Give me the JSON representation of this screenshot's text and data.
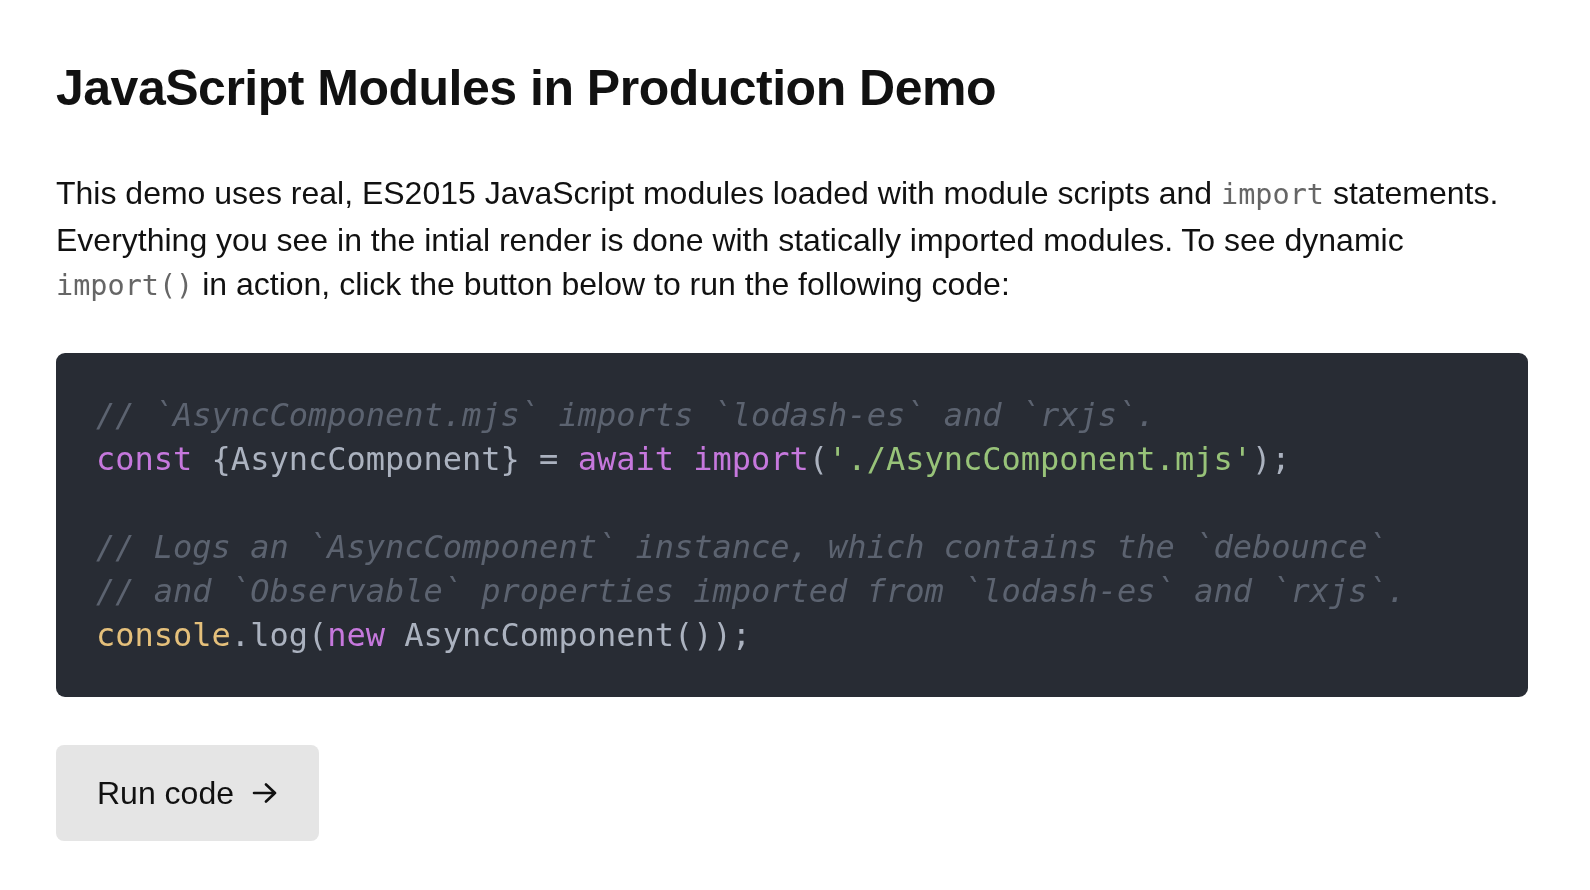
{
  "title": "JavaScript Modules in Production Demo",
  "intro": [
    {
      "kind": "text",
      "text": "This demo uses real, ES2015 JavaScript modules loaded with module scripts and "
    },
    {
      "kind": "code",
      "text": "import"
    },
    {
      "kind": "text",
      "text": " statements. Everything you see in the intial render is done with statically imported modules. To see dynamic "
    },
    {
      "kind": "code",
      "text": "import()"
    },
    {
      "kind": "text",
      "text": " in action, click the button below to run the following code:"
    }
  ],
  "code_block": {
    "groups": [
      [
        [
          {
            "kind": "comment",
            "text": "// `AsyncComponent.mjs` imports `lodash-es` and `rxjs`."
          }
        ],
        [
          {
            "kind": "keyword",
            "text": "const"
          },
          {
            "kind": "plain",
            "text": " {AsyncComponent} = "
          },
          {
            "kind": "keyword",
            "text": "await "
          },
          {
            "kind": "keyword",
            "text": "import"
          },
          {
            "kind": "plain",
            "text": "("
          },
          {
            "kind": "string",
            "text": "'./AsyncComponent.mjs'"
          },
          {
            "kind": "plain",
            "text": ");"
          }
        ]
      ],
      [
        [
          {
            "kind": "comment",
            "text": "// Logs an `AsyncComponent` instance, which contains the `debounce`"
          }
        ],
        [
          {
            "kind": "comment",
            "text": "// and `Observable` properties imported from `lodash-es` and `rxjs`."
          }
        ],
        [
          {
            "kind": "builtin",
            "text": "console"
          },
          {
            "kind": "plain",
            "text": ".log("
          },
          {
            "kind": "keyword",
            "text": "new"
          },
          {
            "kind": "plain",
            "text": " AsyncComponent());"
          }
        ]
      ]
    ]
  },
  "run_button": {
    "label": "Run code"
  }
}
